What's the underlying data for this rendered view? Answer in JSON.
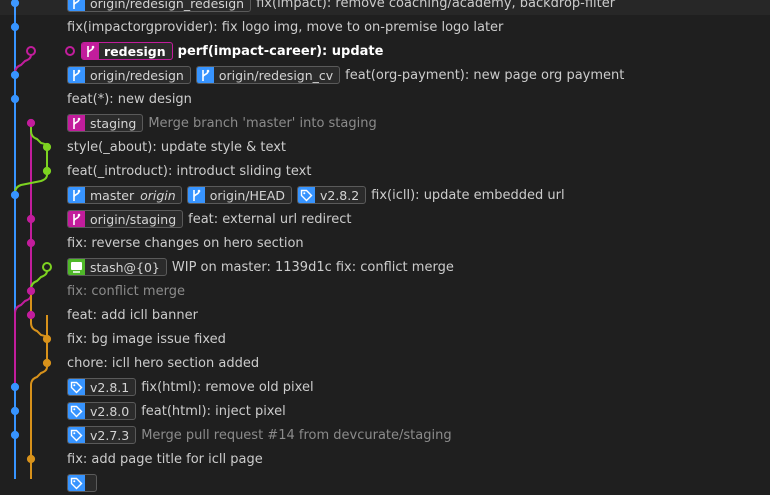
{
  "colors": {
    "blue": "#3794ff",
    "magenta": "#c21d9c",
    "green": "#7dd321",
    "orange": "#d8921b",
    "tag_blue": "#3794ff",
    "stash_green": "#4fb829"
  },
  "commits": [
    {
      "refs": [
        {
          "kind": "remote-branch",
          "icon": "branch-icon",
          "color": "blue",
          "label": "origin/redesign_redesign"
        }
      ],
      "message": "fix(impact): remove coaching/academy, backdrop-filter",
      "style": "normal"
    },
    {
      "refs": [],
      "message": "fix(impactorgprovider): fix logo img, move to on-premise logo later",
      "style": "normal"
    },
    {
      "refs": [
        {
          "kind": "local-branch",
          "icon": "branch-icon",
          "color": "magenta",
          "label": "redesign",
          "current": true
        }
      ],
      "message": "perf(impact-career): update",
      "style": "bold"
    },
    {
      "refs": [
        {
          "kind": "remote-branch",
          "icon": "branch-icon",
          "color": "blue",
          "label": "origin/redesign"
        },
        {
          "kind": "remote-branch",
          "icon": "branch-icon",
          "color": "blue",
          "label": "origin/redesign_cv"
        }
      ],
      "message": "feat(org-payment): new page org payment",
      "style": "normal"
    },
    {
      "refs": [],
      "message": "feat(*): new design",
      "style": "normal"
    },
    {
      "refs": [
        {
          "kind": "local-branch",
          "icon": "branch-icon",
          "color": "magenta",
          "label": "staging"
        }
      ],
      "message": "Merge branch 'master' into staging",
      "style": "dim"
    },
    {
      "refs": [],
      "message": "style(_about): update style & text",
      "style": "normal"
    },
    {
      "refs": [],
      "message": "feat(_introduct): introduct sliding text",
      "style": "normal"
    },
    {
      "refs": [
        {
          "kind": "local-branch",
          "icon": "branch-icon",
          "color": "blue",
          "label": "master",
          "sub": "origin"
        },
        {
          "kind": "remote-branch",
          "icon": "branch-icon",
          "color": "blue",
          "label": "origin/HEAD"
        },
        {
          "kind": "tag",
          "icon": "tag-icon",
          "color": "tag_blue",
          "label": "v2.8.2"
        }
      ],
      "message": "fix(icll): update embedded url",
      "style": "normal"
    },
    {
      "refs": [
        {
          "kind": "remote-branch",
          "icon": "branch-icon",
          "color": "magenta",
          "label": "origin/staging"
        }
      ],
      "message": "feat: external url redirect",
      "style": "normal"
    },
    {
      "refs": [],
      "message": "fix: reverse changes on hero section",
      "style": "normal"
    },
    {
      "refs": [
        {
          "kind": "stash",
          "icon": "stash-icon",
          "color": "stash_green",
          "label": "stash@{0}"
        }
      ],
      "message": "WIP on master: 1139d1c fix: conflict merge",
      "style": "normal"
    },
    {
      "refs": [],
      "message": "fix: conflict merge",
      "style": "dim"
    },
    {
      "refs": [],
      "message": "feat: add icll banner",
      "style": "normal"
    },
    {
      "refs": [],
      "message": "fix: bg image issue fixed",
      "style": "normal"
    },
    {
      "refs": [],
      "message": "chore: icll hero section added",
      "style": "normal"
    },
    {
      "refs": [
        {
          "kind": "tag",
          "icon": "tag-icon",
          "color": "tag_blue",
          "label": "v2.8.1"
        }
      ],
      "message": "fix(html): remove old pixel",
      "style": "normal"
    },
    {
      "refs": [
        {
          "kind": "tag",
          "icon": "tag-icon",
          "color": "tag_blue",
          "label": "v2.8.0"
        }
      ],
      "message": "feat(html): inject pixel",
      "style": "normal"
    },
    {
      "refs": [
        {
          "kind": "tag",
          "icon": "tag-icon",
          "color": "tag_blue",
          "label": "v2.7.3"
        }
      ],
      "message": "Merge pull request #14 from devcurate/staging",
      "style": "dim"
    },
    {
      "refs": [],
      "message": "fix: add page title for icll page",
      "style": "normal"
    },
    {
      "refs": [
        {
          "kind": "tag",
          "icon": "tag-icon",
          "color": "tag_blue",
          "label": ""
        }
      ],
      "message": "",
      "style": "normal"
    }
  ]
}
